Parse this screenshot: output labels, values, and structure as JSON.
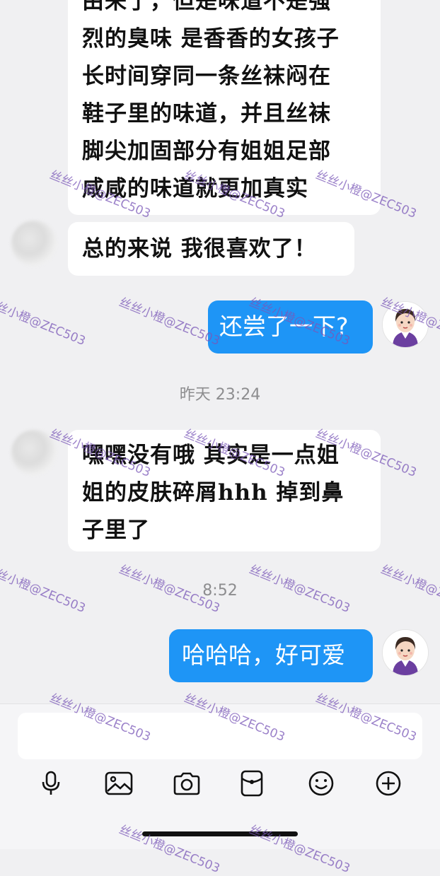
{
  "messages": [
    {
      "direction": "in",
      "text": "由来了，但是味道不是强\n烈的臭味 是香香的女孩子\n长时间穿同一条丝袜闷在\n鞋子里的味道，并且丝袜\n脚尖加固部分有姐姐足部\n咸咸的味道就更加真实"
    },
    {
      "direction": "in",
      "text": "总的来说 我很喜欢了！"
    },
    {
      "direction": "out",
      "text": "还尝了一下?"
    },
    {
      "direction": "in",
      "text": "嘿嘿没有哦 其实是一点姐\n姐的皮肤碎屑hhh 掉到鼻\n子里了"
    },
    {
      "direction": "out",
      "text": "哈哈哈，好可爱"
    }
  ],
  "timestamps": [
    "昨天 23:24",
    "8:52"
  ],
  "watermark": "丝丝小橙@ZEC503",
  "input": {
    "placeholder": ""
  },
  "toolbar": [
    "microphone-icon",
    "image-icon",
    "camera-icon",
    "red-packet-icon",
    "emoji-icon",
    "plus-icon"
  ],
  "colors": {
    "out_bubble": "#1e95f6",
    "in_bubble": "#ffffff",
    "background": "#f0f0f2",
    "watermark": "#7a57b8"
  }
}
